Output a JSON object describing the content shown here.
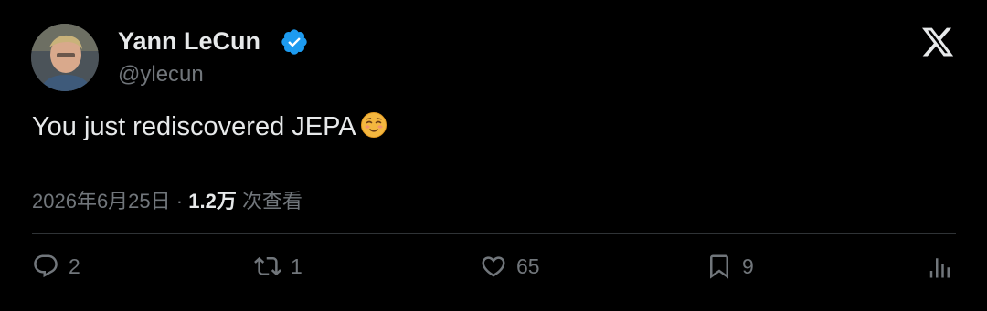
{
  "tweet": {
    "author": {
      "name": "Yann LeCun",
      "handle": "@ylecun",
      "verified": true
    },
    "text": "You just rediscovered JEPA",
    "emoji": "relieved-smiling-face",
    "timestamp": "2026年6月25日",
    "separator": "·",
    "views_count": "1.2万",
    "views_label": "次查看",
    "actions": {
      "reply_count": "2",
      "retweet_count": "1",
      "like_count": "65",
      "bookmark_count": "9"
    }
  },
  "colors": {
    "background": "#000000",
    "primary_text": "#e7e9ea",
    "secondary_text": "#71767b",
    "verified_badge": "#1d9bf0",
    "divider": "#2f3336"
  },
  "icons": [
    "verified-badge-icon",
    "x-logo-icon",
    "reply-icon",
    "retweet-icon",
    "like-icon",
    "bookmark-icon",
    "analytics-icon"
  ]
}
